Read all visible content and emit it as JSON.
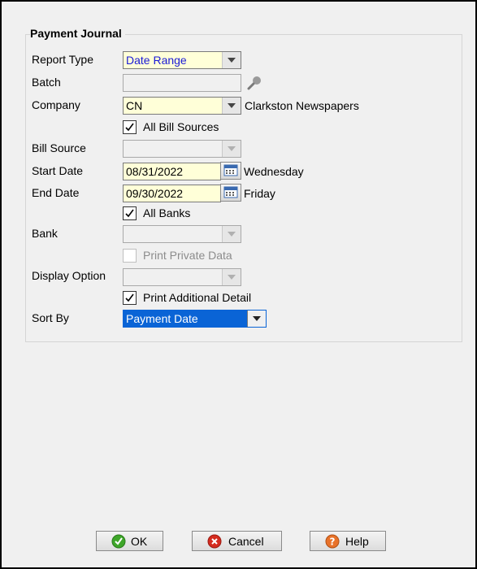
{
  "group": {
    "title": "Payment Journal"
  },
  "labels": {
    "report_type": "Report Type",
    "batch": "Batch",
    "company": "Company",
    "bill_source": "Bill Source",
    "start_date": "Start Date",
    "end_date": "End Date",
    "bank": "Bank",
    "display_option": "Display Option",
    "sort_by": "Sort By"
  },
  "fields": {
    "report_type": "Date Range",
    "batch": "",
    "company": "CN",
    "company_name": "Clarkston Newspapers",
    "bill_source": "",
    "start_date": "08/31/2022",
    "start_day": "Wednesday",
    "end_date": "09/30/2022",
    "end_day": "Friday",
    "bank": "",
    "display_option": "",
    "sort_by": "Payment Date"
  },
  "checkboxes": {
    "all_bill_sources": {
      "label": "All Bill Sources",
      "checked": true
    },
    "all_banks": {
      "label": "All Banks",
      "checked": true
    },
    "print_private_data": {
      "label": "Print Private Data",
      "checked": false,
      "enabled": false
    },
    "print_additional_detail": {
      "label": "Print Additional Detail",
      "checked": true
    }
  },
  "buttons": {
    "ok": "OK",
    "cancel": "Cancel",
    "help": "Help"
  },
  "colors": {
    "report_type_text": "#1a1ad6",
    "sort_by_bg": "#0a64d6",
    "ok_icon": "#3ea629",
    "cancel_icon": "#d52b1e",
    "help_icon": "#e8722a"
  }
}
